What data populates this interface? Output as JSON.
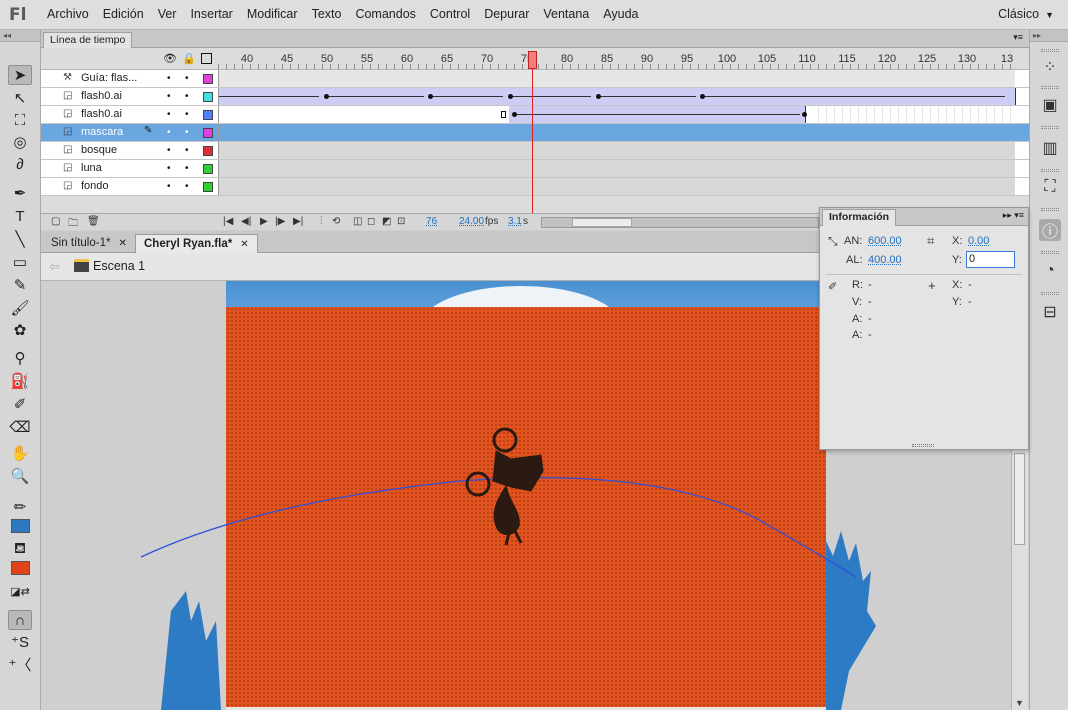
{
  "app": {
    "logo": "Fl",
    "workspace": "Clásico"
  },
  "menu": [
    "Archivo",
    "Edición",
    "Ver",
    "Insertar",
    "Modificar",
    "Texto",
    "Comandos",
    "Control",
    "Depurar",
    "Ventana",
    "Ayuda"
  ],
  "timeline": {
    "tab": "Línea de tiempo",
    "ruler": [
      "40",
      "45",
      "50",
      "55",
      "60",
      "65",
      "70",
      "75",
      "80",
      "85",
      "90",
      "95",
      "100",
      "105",
      "110",
      "115",
      "120",
      "125",
      "130",
      "13"
    ],
    "layers": [
      {
        "name": "Guía: flas...",
        "color": "#e040e0",
        "type": "guide"
      },
      {
        "name": "flash0.ai",
        "color": "#40e0e0",
        "type": "guided"
      },
      {
        "name": "flash0.ai",
        "color": "#5080ff",
        "type": "guided"
      },
      {
        "name": "mascara",
        "color": "#e040e0",
        "type": "mask",
        "selected": true
      },
      {
        "name": "bosque",
        "color": "#e03030",
        "type": "masked"
      },
      {
        "name": "luna",
        "color": "#30d030",
        "type": "masked"
      },
      {
        "name": "fondo",
        "color": "#30d030",
        "type": "masked"
      }
    ],
    "footer": {
      "frame": "76",
      "fps": "24.00",
      "fps_unit": "fps",
      "time": "3.1",
      "time_unit": "s"
    }
  },
  "documents": [
    {
      "name": "Sin título-1*",
      "active": false
    },
    {
      "name": "Cheryl Ryan.fla*",
      "active": true
    }
  ],
  "scene": "Escena 1",
  "info_panel": {
    "title": "Información",
    "an_label": "AN:",
    "an_value": "600.00",
    "al_label": "AL:",
    "al_value": "400.00",
    "x_label": "X:",
    "x_value": "0.00",
    "y_label": "Y:",
    "y_value": "0",
    "r_label": "R:",
    "r_value": "-",
    "v_label": "V:",
    "v_value": "-",
    "a1_label": "A:",
    "a1_value": "-",
    "a2_label": "A:",
    "a2_value": "-",
    "x2_label": "X:",
    "x2_value": "-",
    "y2_label": "Y:",
    "y2_value": "-"
  },
  "colors": {
    "stroke": "#2e78c2",
    "fill": "#e2441a",
    "mask_layer": "#6aa7e0",
    "tween": "#ccccf5"
  }
}
